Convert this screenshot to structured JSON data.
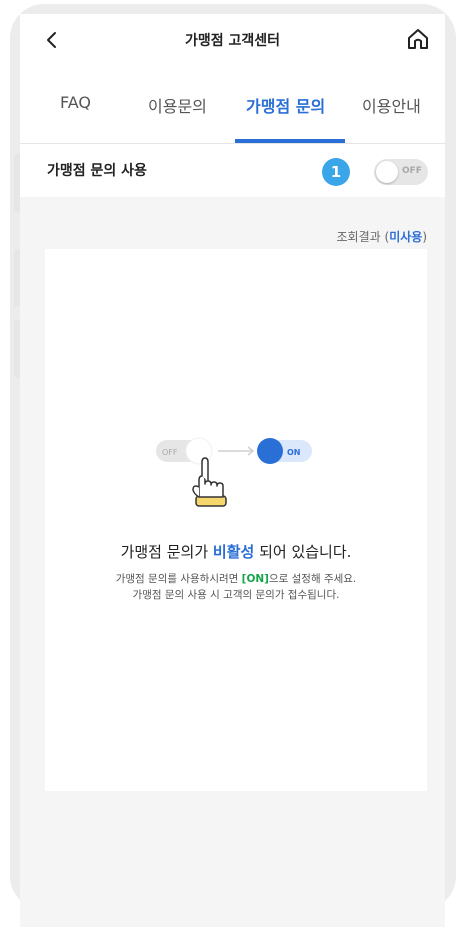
{
  "header": {
    "title": "가맹점 고객센터"
  },
  "tabs": [
    {
      "label": "FAQ"
    },
    {
      "label": "이용문의"
    },
    {
      "label": "가맹점 문의"
    },
    {
      "label": "이용안내"
    }
  ],
  "active_tab_index": 2,
  "setting": {
    "label": "가맹점 문의 사용",
    "badge_number": "1",
    "toggle_state": "OFF"
  },
  "result": {
    "prefix": "조회결과 (",
    "status": "미사용",
    "suffix": ")"
  },
  "illustration": {
    "off_label": "OFF",
    "on_label": "ON"
  },
  "message": {
    "pre": "가맹점 문의가 ",
    "highlight": "비활성",
    "post": " 되어 있습니다.",
    "sub1_pre": "가맹점 문의를 사용하시려면 ",
    "sub1_on": "[ON]",
    "sub1_post": "으로 설정해 주세요.",
    "sub2": "가맹점 문의 사용 시 고객의 문의가 접수됩니다."
  },
  "colors": {
    "accent": "#2a6fd6",
    "badge": "#3aa5e8",
    "on_green": "#16a34a"
  }
}
